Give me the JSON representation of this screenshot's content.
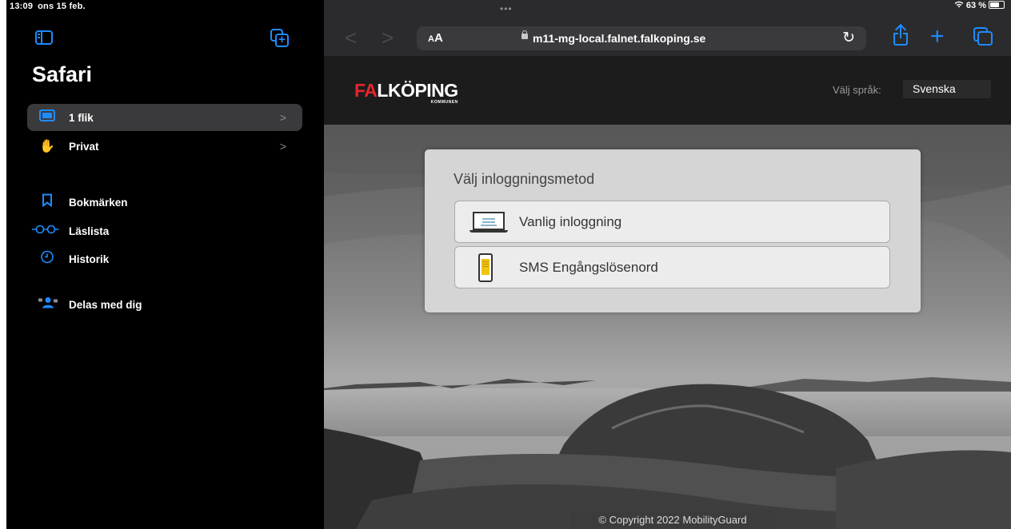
{
  "status": {
    "time": "13:09",
    "date": "ons 15 feb.",
    "battery": "63 %",
    "more_dots": "•••"
  },
  "sidebar": {
    "title": "Safari",
    "items": [
      {
        "label": "1 flik",
        "icon": "tab-icon",
        "chevron": ">"
      },
      {
        "label": "Privat",
        "icon": "hand-icon",
        "chevron": ">"
      },
      {
        "label": "Bokmärken",
        "icon": "bookmark-icon"
      },
      {
        "label": "Läslista",
        "icon": "glasses-icon"
      },
      {
        "label": "Historik",
        "icon": "clock-icon"
      },
      {
        "label": "Delas med dig",
        "icon": "shared-people-icon"
      }
    ]
  },
  "toolbar": {
    "back": "<",
    "forward": ">",
    "aa_label": "A",
    "aa_label_big": "A",
    "url": "m11-mg-local.falnet.falkoping.se",
    "reload": "↻",
    "plus": "+"
  },
  "site": {
    "logo_red": "FA",
    "logo_rest": "LKÖPING",
    "logo_sub": "KOMMUNEN",
    "lang_label": "Välj språk:",
    "lang_value": "Svenska",
    "login_title": "Välj inloggningsmetod",
    "method1": "Vanlig inloggning",
    "method2": "SMS Engångslösenord",
    "copyright": "© Copyright 2022 MobilityGuard"
  },
  "colors": {
    "accent": "#1e8bff",
    "brand_red": "#e4262d",
    "sidebar_bg": "#000000",
    "toolbar_bg": "#2b2b2d"
  }
}
